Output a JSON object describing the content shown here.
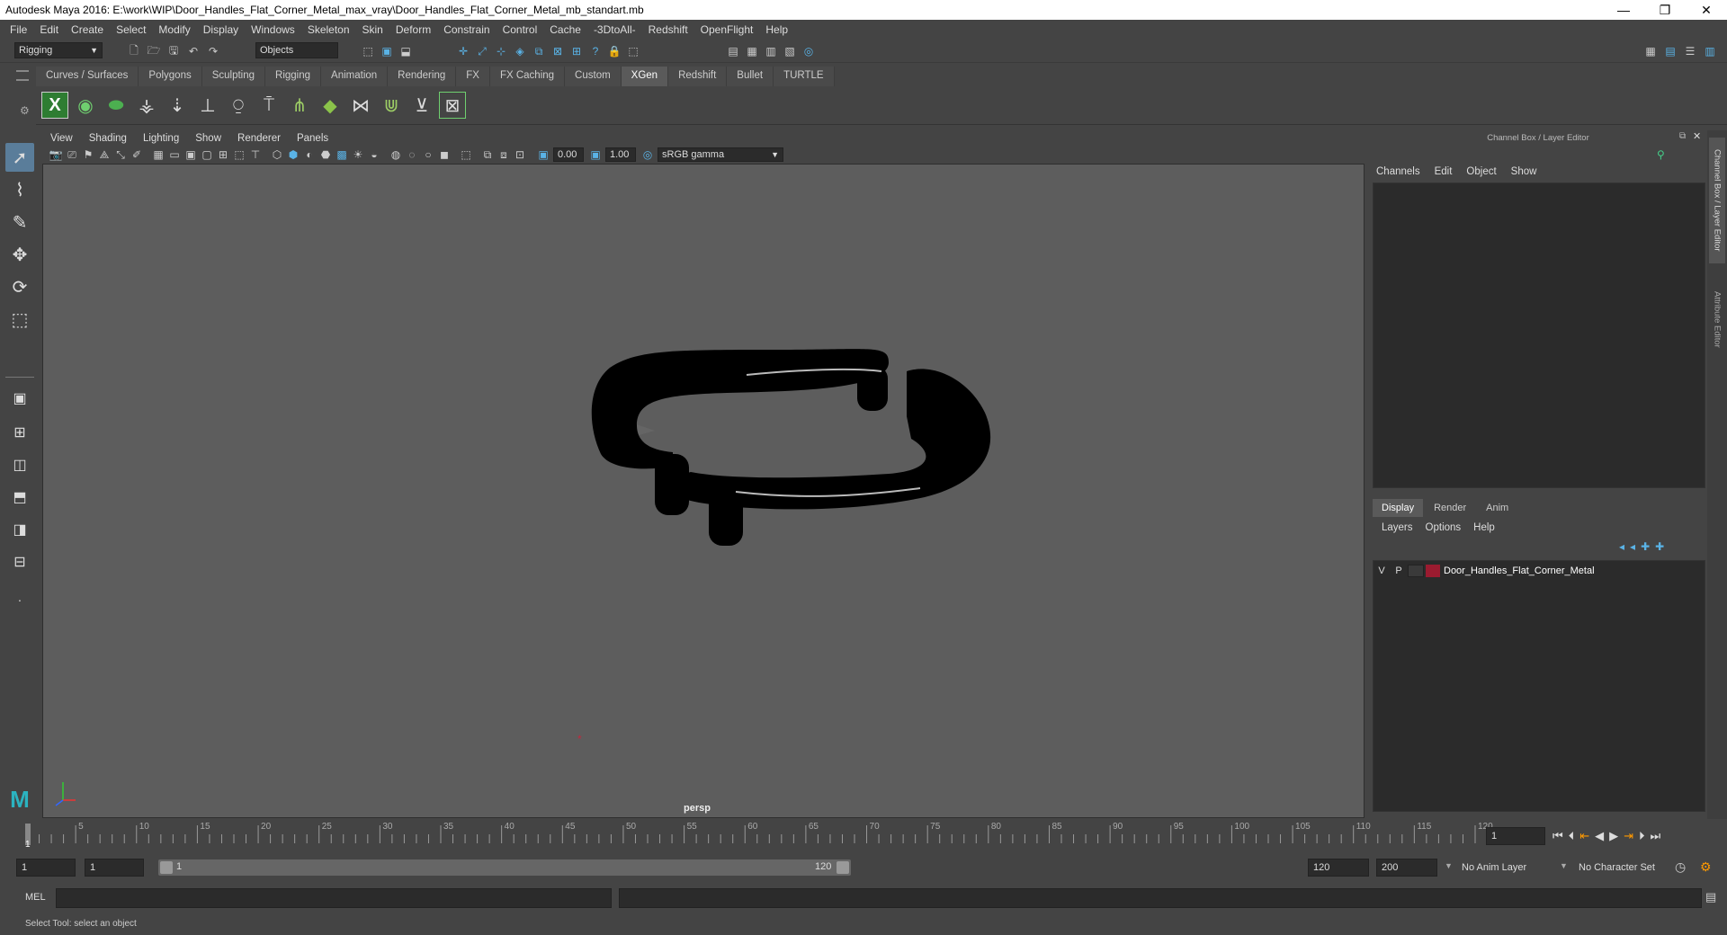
{
  "window": {
    "title": "Autodesk Maya 2016: E:\\work\\WIP\\Door_Handles_Flat_Corner_Metal_max_vray\\Door_Handles_Flat_Corner_Metal_mb_standart.mb",
    "minimize": "—",
    "restore": "❐",
    "close": "✕"
  },
  "menubar": [
    "File",
    "Edit",
    "Create",
    "Select",
    "Modify",
    "Display",
    "Windows",
    "Skeleton",
    "Skin",
    "Deform",
    "Constrain",
    "Control",
    "Cache",
    "-3DtoAll-",
    "Redshift",
    "OpenFlight",
    "Help"
  ],
  "statusline": {
    "menuset": "Rigging",
    "selection_mode": "Objects"
  },
  "shelf": {
    "tabs": [
      "Curves / Surfaces",
      "Polygons",
      "Sculpting",
      "Rigging",
      "Animation",
      "Rendering",
      "FX",
      "FX Caching",
      "Custom",
      "XGen",
      "Redshift",
      "Bullet",
      "TURTLE"
    ],
    "active_tab": "XGen"
  },
  "panel": {
    "menus": [
      "View",
      "Shading",
      "Lighting",
      "Show",
      "Renderer",
      "Panels"
    ],
    "exposure": "0.00",
    "gamma": "1.00",
    "colorspace": "sRGB gamma",
    "camera_label": "persp"
  },
  "channel_box": {
    "title": "Channel Box / Layer Editor",
    "menus": [
      "Channels",
      "Edit",
      "Object",
      "Show"
    ]
  },
  "layer_editor": {
    "tabs": [
      "Display",
      "Render",
      "Anim"
    ],
    "active_tab": "Display",
    "menus": [
      "Layers",
      "Options",
      "Help"
    ],
    "layers": [
      {
        "visible": "V",
        "playback": "P",
        "name": "Door_Handles_Flat_Corner_Metal",
        "color": "#9b1b30"
      }
    ]
  },
  "side_tabs": [
    "Channel Box / Layer Editor",
    "Attribute Editor"
  ],
  "timeline": {
    "ticks": [
      "5",
      "10",
      "15",
      "20",
      "25",
      "30",
      "35",
      "40",
      "45",
      "50",
      "55",
      "60",
      "65",
      "70",
      "75",
      "80",
      "85",
      "90",
      "95",
      "100",
      "105",
      "110",
      "115",
      "120"
    ],
    "start_tick": "1",
    "current_frame": "1"
  },
  "range": {
    "start": "1",
    "playback_start": "1",
    "slider_start": "1",
    "slider_end": "120",
    "playback_end": "120",
    "end": "200",
    "anim_layer": "No Anim Layer",
    "character_set": "No Character Set"
  },
  "command_line": {
    "label": "MEL"
  },
  "help_line": "Select Tool: select an object",
  "colors": {
    "accent": "#5ab3e6",
    "layer_red": "#9b1b30",
    "viewport_bg": "#5d5d5d"
  }
}
